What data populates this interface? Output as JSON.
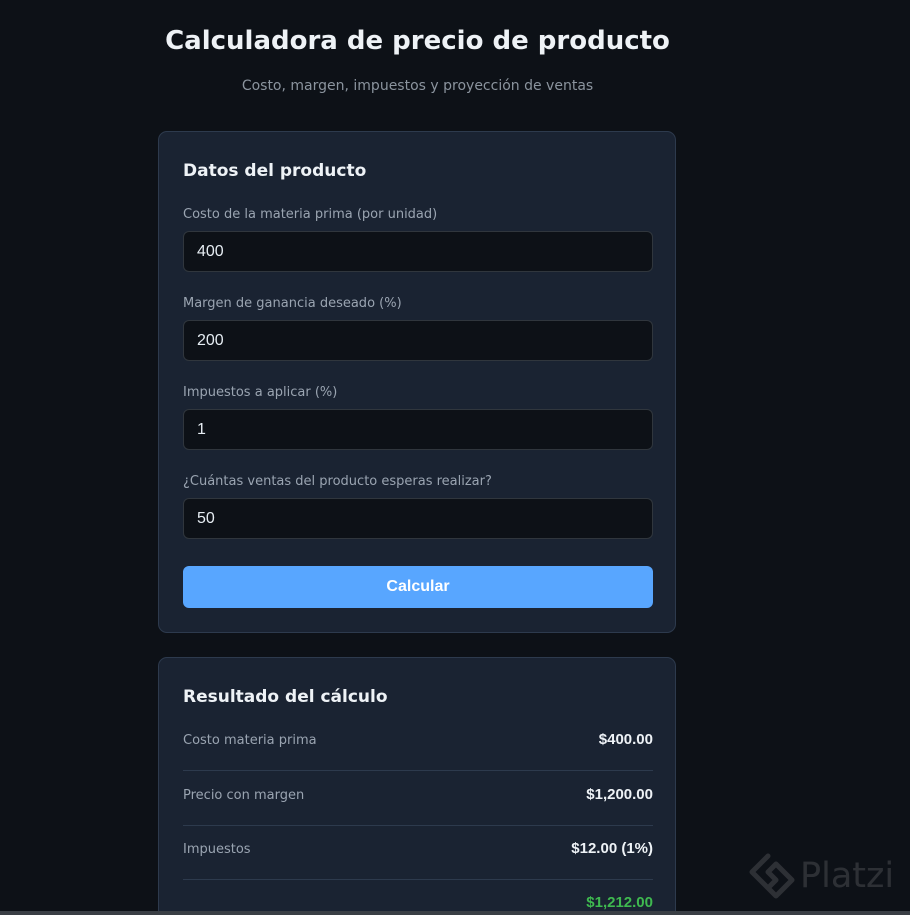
{
  "header": {
    "title": "Calculadora de precio de producto",
    "subtitle": "Costo, margen, impuestos y proyección de ventas"
  },
  "product_form": {
    "title": "Datos del producto",
    "fields": [
      {
        "label": "Costo de la materia prima (por unidad)",
        "value": "400"
      },
      {
        "label": "Margen de ganancia deseado (%)",
        "value": "200"
      },
      {
        "label": "Impuestos a aplicar (%)",
        "value": "1"
      },
      {
        "label": "¿Cuántas ventas del producto esperas realizar?",
        "value": "50"
      }
    ],
    "submit_label": "Calcular"
  },
  "results": {
    "title": "Resultado del cálculo",
    "rows": [
      {
        "label": "Costo materia prima",
        "value": "$400.00"
      },
      {
        "label": "Precio con margen",
        "value": "$1,200.00"
      },
      {
        "label": "Impuestos",
        "value": "$12.00 (1%)"
      },
      {
        "label": "",
        "value": "$1,212.00"
      }
    ]
  },
  "watermark": {
    "brand": "Platzi",
    "icon": "platzi-logo-icon"
  },
  "colors": {
    "background": "#0d1117",
    "card": "#1a2332",
    "accent": "#58a6ff",
    "positive": "#3fb950"
  }
}
